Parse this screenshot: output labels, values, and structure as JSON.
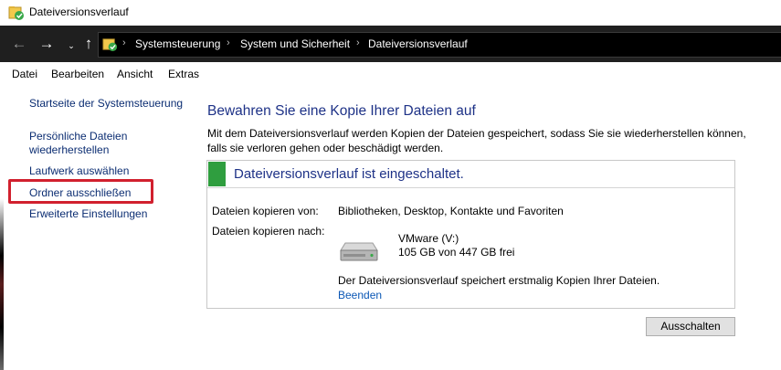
{
  "window": {
    "title": "Dateiversionsverlauf"
  },
  "address": {
    "crumbs": [
      "Systemsteuerung",
      "System und Sicherheit",
      "Dateiversionsverlauf"
    ]
  },
  "nav_icons": {
    "back": "back-arrow-icon",
    "forward": "forward-arrow-icon",
    "recent": "chevron-down-icon",
    "up": "up-arrow-icon"
  },
  "menu": [
    {
      "label": "Datei"
    },
    {
      "label": "Bearbeiten"
    },
    {
      "label": "Ansicht"
    },
    {
      "label": "Extras"
    }
  ],
  "leftnav": {
    "home": "Startseite der Systemsteuerung",
    "restore_line1": "Persönliche Dateien",
    "restore_line2": "wiederherstellen",
    "select_drive": "Laufwerk auswählen",
    "exclude": "Ordner ausschließen",
    "advanced": "Erweiterte Einstellungen"
  },
  "main": {
    "heading": "Bewahren Sie eine Kopie Ihrer Dateien auf",
    "description": "Mit dem Dateiversionsverlauf werden Kopien der Dateien gespeichert, sodass Sie sie wiederherstellen können, falls sie verloren gehen oder beschädigt werden.",
    "status": "Dateiversionsverlauf ist eingeschaltet.",
    "copy_from_label": "Dateien kopieren von:",
    "copy_from_value": "Bibliotheken, Desktop, Kontakte und Favoriten",
    "copy_to_label": "Dateien kopieren nach:",
    "drive_name": "VMware (V:)",
    "drive_free": "105 GB von 447 GB frei",
    "info": "Der Dateiversionsverlauf speichert erstmalig Kopien Ihrer Dateien.",
    "stop_link": "Beenden",
    "turn_off_button": "Ausschalten"
  },
  "colors": {
    "accent_green": "#2f9e3f",
    "link_blue": "#0b57b5",
    "heading_blue": "#1e3287",
    "highlight_red": "#d1202e"
  }
}
